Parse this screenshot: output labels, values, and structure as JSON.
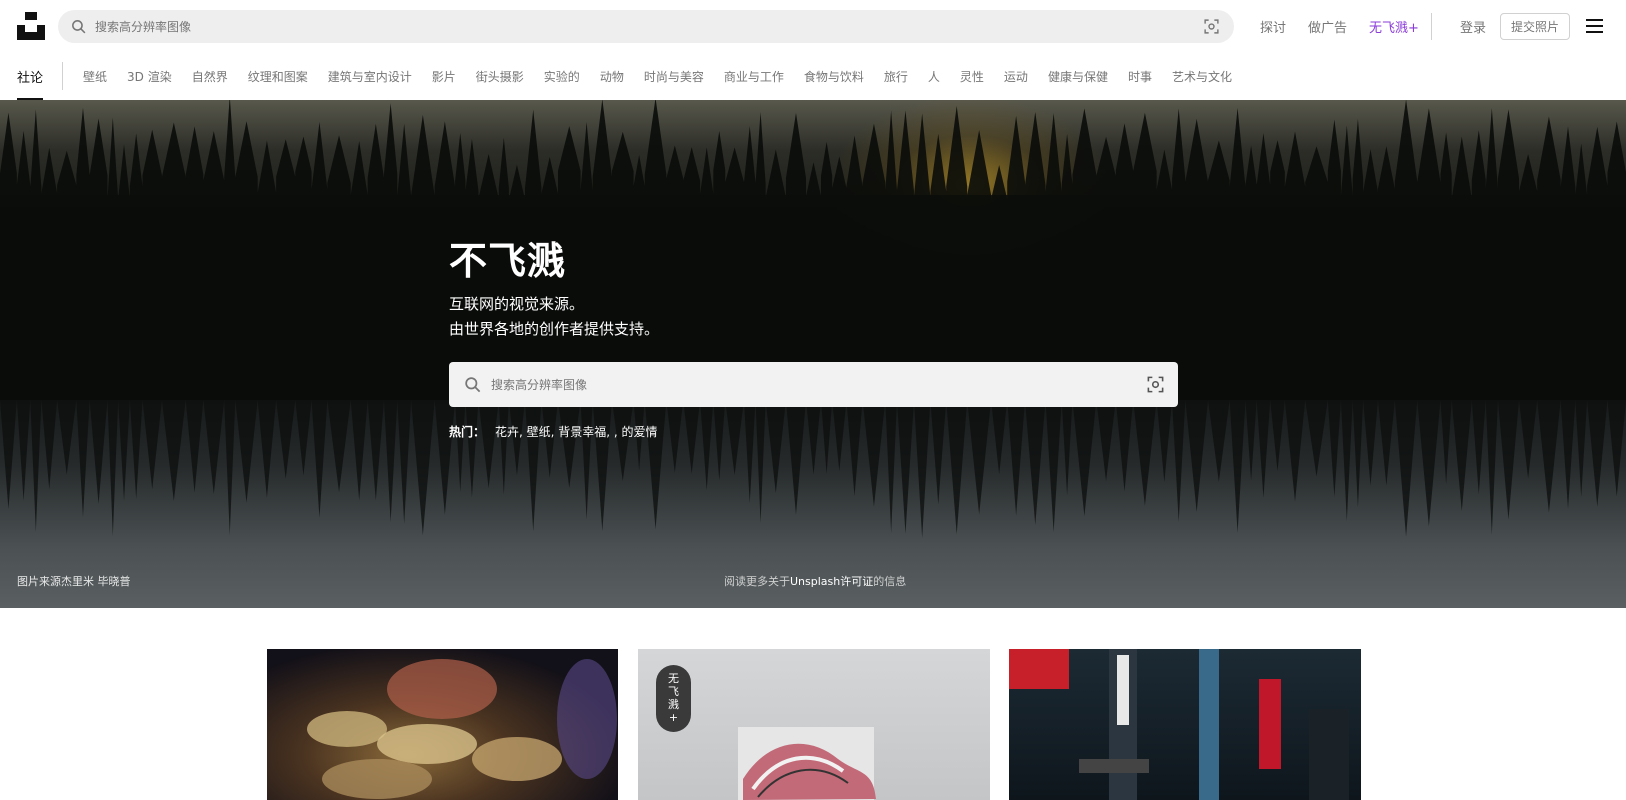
{
  "header": {
    "search_placeholder": "搜索高分辨率图像",
    "links": [
      "探讨",
      "做广告",
      "无飞溅+"
    ],
    "login": "登录",
    "submit": "提交照片",
    "icons": {
      "logo": "unsplash-logo",
      "search": "search-icon",
      "visual_search": "visual-search-icon",
      "menu": "hamburger-menu-icon"
    }
  },
  "categories": {
    "active": "社论",
    "items": [
      "壁纸",
      "3D 渲染",
      "自然界",
      "纹理和图案",
      "建筑与室内设计",
      "影片",
      "街头摄影",
      "实验的",
      "动物",
      "时尚与美容",
      "商业与工作",
      "食物与饮料",
      "旅行",
      "人",
      "灵性",
      "运动",
      "健康与保健",
      "时事",
      "艺术与文化"
    ]
  },
  "hero": {
    "title": "不飞溅",
    "line1": "互联网的视觉来源。",
    "line2": "由世界各地的创作者提供支持。",
    "search_placeholder": "搜索高分辨率图像",
    "trending_label": "热门：",
    "trending_items": "花卉, 壁纸, 背景幸福, , 的爱情",
    "credit": "图片来源杰里米 毕晓普",
    "license_prefix": "阅读更多关于",
    "license_link": "Unsplash许可证",
    "license_suffix": "的信息"
  },
  "grid": {
    "badge_chars": [
      "无",
      "飞",
      "溅",
      "+"
    ]
  },
  "colors": {
    "accent_plus": "#8a3bd8",
    "text_muted": "#767676",
    "search_bg": "#eeeeee"
  }
}
